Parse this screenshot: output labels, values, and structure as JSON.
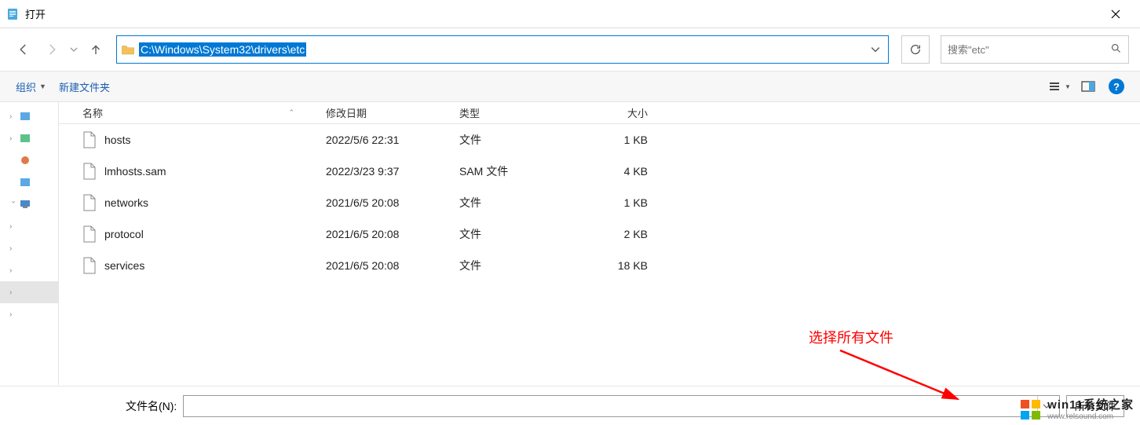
{
  "titlebar": {
    "title": "打开"
  },
  "address": {
    "path": "C:\\Windows\\System32\\drivers\\etc"
  },
  "search": {
    "placeholder": "搜索\"etc\""
  },
  "toolbar": {
    "organize": "组织",
    "new_folder": "新建文件夹"
  },
  "columns": {
    "name": "名称",
    "date": "修改日期",
    "type": "类型",
    "size": "大小"
  },
  "files": [
    {
      "name": "hosts",
      "date": "2022/5/6 22:31",
      "type": "文件",
      "size": "1 KB"
    },
    {
      "name": "lmhosts.sam",
      "date": "2022/3/23 9:37",
      "type": "SAM 文件",
      "size": "4 KB"
    },
    {
      "name": "networks",
      "date": "2021/6/5 20:08",
      "type": "文件",
      "size": "1 KB"
    },
    {
      "name": "protocol",
      "date": "2021/6/5 20:08",
      "type": "文件",
      "size": "2 KB"
    },
    {
      "name": "services",
      "date": "2021/6/5 20:08",
      "type": "文件",
      "size": "18 KB"
    }
  ],
  "footer": {
    "filename_label": "文件名(N):",
    "filter_label": "所有文件"
  },
  "annotation": {
    "text": "选择所有文件"
  },
  "watermark": {
    "title": "win11系统之家",
    "url": "www.relsound.com"
  }
}
